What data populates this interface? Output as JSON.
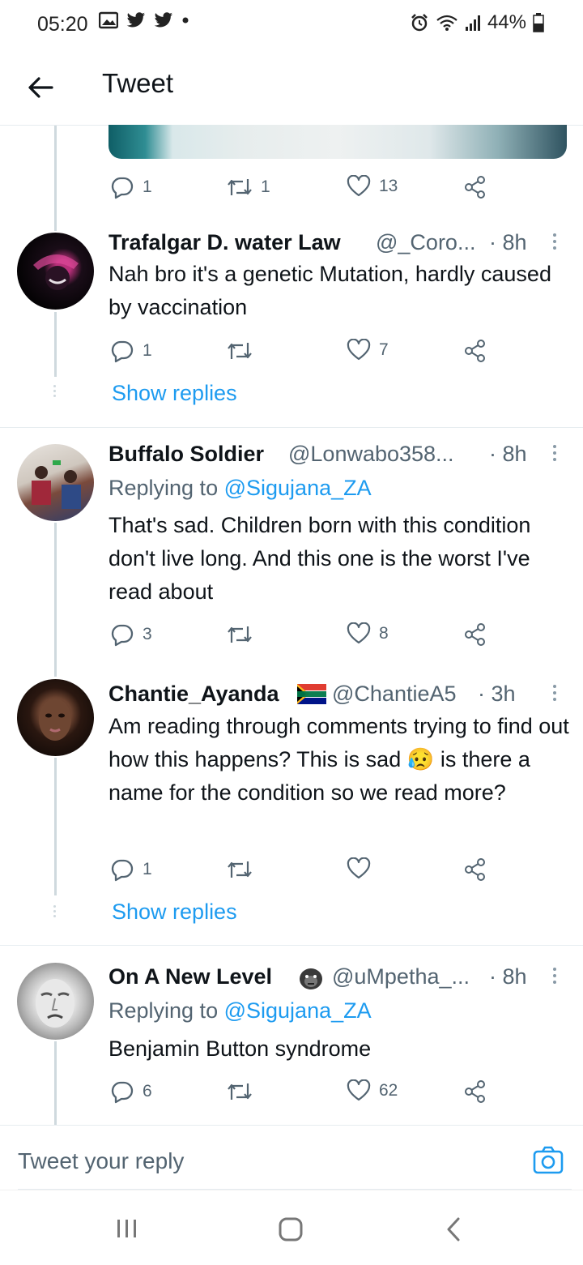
{
  "status": {
    "time": "05:20",
    "battery": "44%"
  },
  "header": {
    "title": "Tweet"
  },
  "top_tweet_actions": {
    "replies": "1",
    "retweets": "1",
    "likes": "13"
  },
  "replies": [
    {
      "name": "Trafalgar D. water Law",
      "handle": "@_Coro...",
      "time": "· 8h",
      "replying_to": "",
      "text": "Nah bro it's a genetic Mutation, hardly caused by vaccination",
      "counts": {
        "replies": "1",
        "retweets": "",
        "likes": "7"
      },
      "show_replies": "Show replies"
    },
    {
      "name": "Buffalo Soldier",
      "handle": "@Lonwabo358...",
      "time": "· 8h",
      "replying_prefix": "Replying to",
      "replying_to": "@Sigujana_ZA",
      "text": "That's sad. Children born with this condition don't live long. And this one is the worst I've read about",
      "counts": {
        "replies": "3",
        "retweets": "",
        "likes": "8"
      }
    },
    {
      "name": "Chantie_Ayanda",
      "handle": "@ChantieA5",
      "time": "· 3h",
      "text_line1": "Am reading through comments trying to find out how this happens? This is sad",
      "emoji": "😥",
      "text_line2": "is there a name for the condition so we read  more?",
      "counts": {
        "replies": "1",
        "retweets": "",
        "likes": ""
      },
      "show_replies": "Show replies"
    },
    {
      "name": "On A New Level",
      "handle": "@uMpetha_...",
      "time": "· 8h",
      "replying_prefix": "Replying to",
      "replying_to": "@Sigujana_ZA",
      "text": "Benjamin Button syndrome",
      "counts": {
        "replies": "6",
        "retweets": "",
        "likes": "62"
      }
    }
  ],
  "reply_bar": {
    "placeholder": "Tweet your reply"
  },
  "colors": {
    "link": "#1d9bf0",
    "muted": "#536471",
    "thread": "#cfd9de"
  }
}
